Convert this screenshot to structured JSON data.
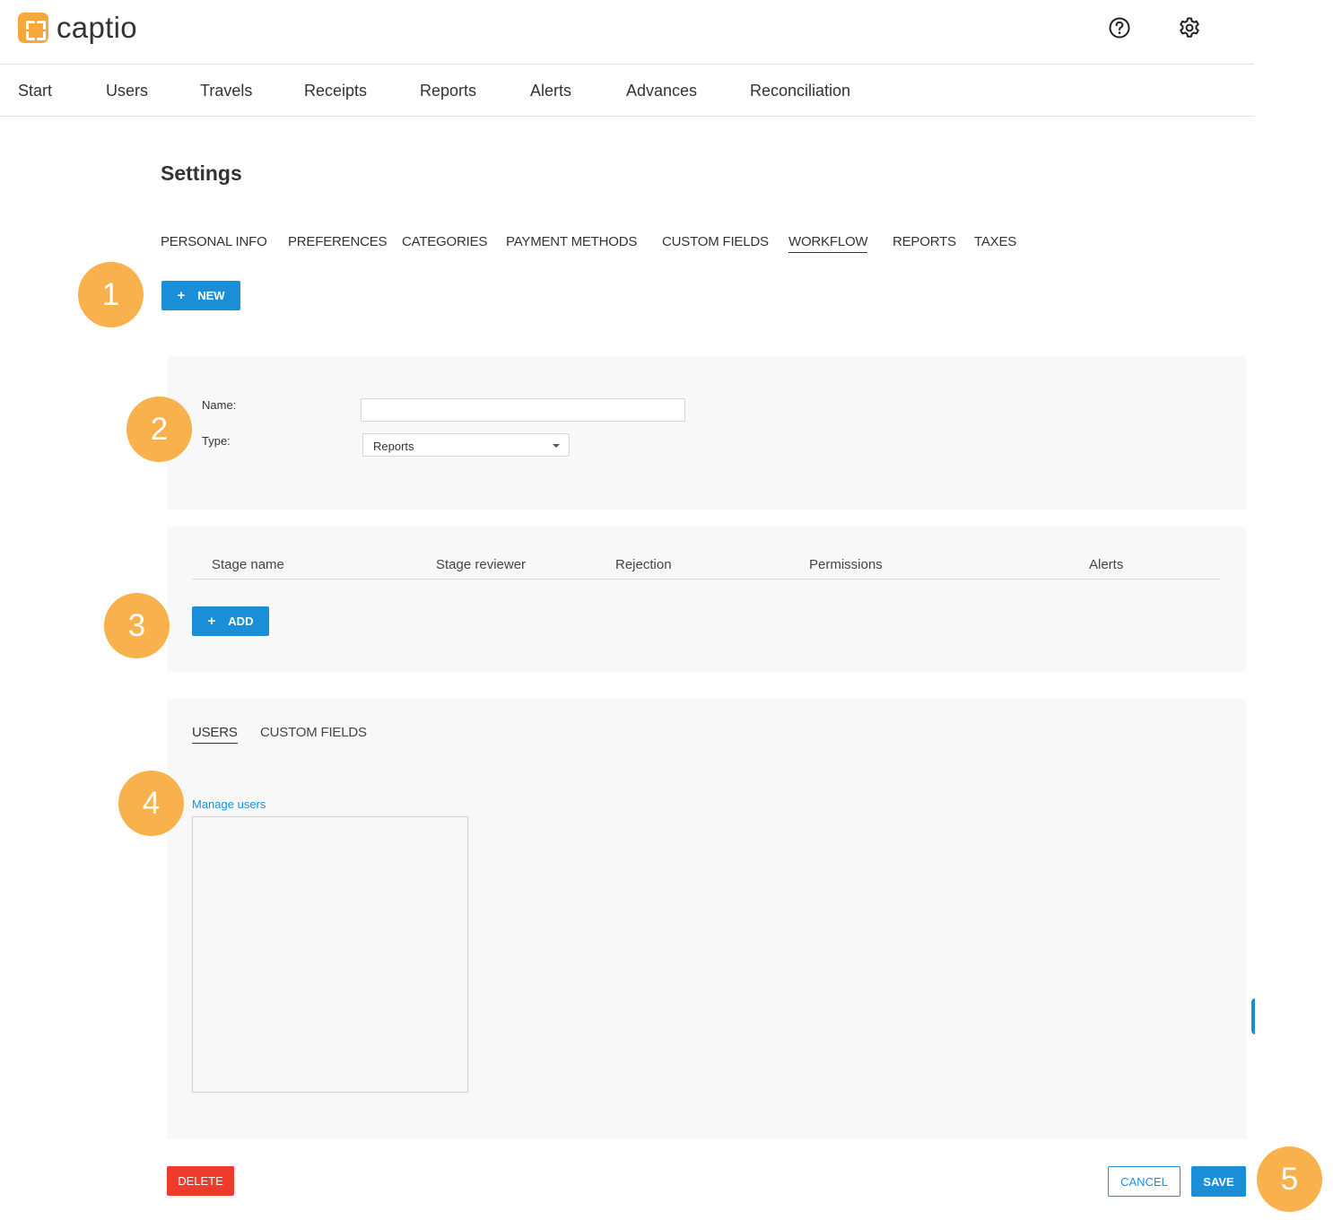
{
  "header": {
    "brand": "captio",
    "help_icon": "help-circle-icon",
    "settings_icon": "gear-icon"
  },
  "mainnav": [
    "Start",
    "Users",
    "Travels",
    "Receipts",
    "Reports",
    "Alerts",
    "Advances",
    "Reconciliation"
  ],
  "page": {
    "title": "Settings",
    "tabs": [
      "PERSONAL INFO",
      "PREFERENCES",
      "CATEGORIES",
      "PAYMENT METHODS",
      "CUSTOM FIELDS",
      "WORKFLOW",
      "REPORTS",
      "TAXES"
    ],
    "active_tab": "WORKFLOW",
    "new_label": "NEW"
  },
  "form": {
    "name_label": "Name:",
    "name_value": "",
    "type_label": "Type:",
    "type_value": "Reports"
  },
  "stages": {
    "columns": [
      "Stage name",
      "Stage reviewer",
      "Rejection",
      "Permissions",
      "Alerts"
    ],
    "add_label": "ADD"
  },
  "assign": {
    "tabs": [
      "USERS",
      "CUSTOM FIELDS"
    ],
    "active_tab": "USERS",
    "manage_link": "Manage users"
  },
  "footer": {
    "delete_label": "DELETE",
    "cancel_label": "CANCEL",
    "save_label": "SAVE"
  },
  "markers": [
    "1",
    "2",
    "3",
    "4",
    "5"
  ],
  "colors": {
    "accent": "#1a8fd8",
    "danger": "#ee3b2c",
    "marker": "#f9b14d",
    "brand": "#f6a83c"
  }
}
